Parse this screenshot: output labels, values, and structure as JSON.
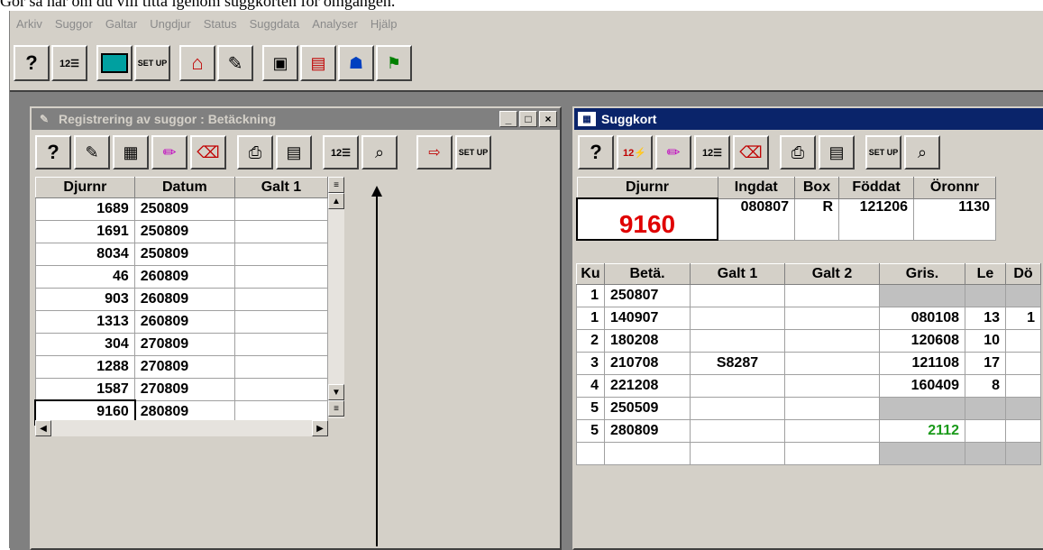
{
  "caption": "Gör så här om du vill titta igenom suggkorten för omgången.",
  "menu": [
    "Arkiv",
    "Suggor",
    "Galtar",
    "Ungdjur",
    "Status",
    "Suggdata",
    "Analyser",
    "Hjälp"
  ],
  "left_window": {
    "title": "Registrering av suggor : Betäckning",
    "columns": [
      "Djurnr",
      "Datum",
      "Galt 1"
    ],
    "rows": [
      [
        "1689",
        "250809",
        ""
      ],
      [
        "1691",
        "250809",
        ""
      ],
      [
        "8034",
        "250809",
        ""
      ],
      [
        "46",
        "260809",
        ""
      ],
      [
        "903",
        "260809",
        ""
      ],
      [
        "1313",
        "260809",
        ""
      ],
      [
        "304",
        "270809",
        ""
      ],
      [
        "1288",
        "270809",
        ""
      ],
      [
        "1587",
        "270809",
        ""
      ],
      [
        "9160",
        "280809",
        ""
      ]
    ]
  },
  "right_window": {
    "title": "Suggkort",
    "header_columns": [
      "Djurnr",
      "Ingdat",
      "Box",
      "Föddat",
      "Öronnr"
    ],
    "header_values": {
      "djurnr": "9160",
      "ingdat": "080807",
      "box": "R",
      "foddat": "121206",
      "oronnr": "1130"
    },
    "columns": [
      "Ku",
      "Betä.",
      "Galt 1",
      "Galt 2",
      "Gris.",
      "Le",
      "Dö"
    ],
    "rows": [
      {
        "ku": "1",
        "beta": "250807",
        "galt1": "",
        "galt2": "",
        "gris": "",
        "le": "",
        "do": "",
        "grey": true,
        "green": false
      },
      {
        "ku": "1",
        "beta": "140907",
        "galt1": "",
        "galt2": "",
        "gris": "080108",
        "le": "13",
        "do": "1",
        "grey": false,
        "green": false
      },
      {
        "ku": "2",
        "beta": "180208",
        "galt1": "",
        "galt2": "",
        "gris": "120608",
        "le": "10",
        "do": "",
        "grey": false,
        "green": false
      },
      {
        "ku": "3",
        "beta": "210708",
        "galt1": "S8287",
        "galt2": "",
        "gris": "121108",
        "le": "17",
        "do": "",
        "grey": false,
        "green": false
      },
      {
        "ku": "4",
        "beta": "221208",
        "galt1": "",
        "galt2": "",
        "gris": "160409",
        "le": "8",
        "do": "",
        "grey": false,
        "green": false
      },
      {
        "ku": "5",
        "beta": "250509",
        "galt1": "",
        "galt2": "",
        "gris": "",
        "le": "",
        "do": "",
        "grey": true,
        "green": false
      },
      {
        "ku": "5",
        "beta": "280809",
        "galt1": "",
        "galt2": "",
        "gris": "2112",
        "le": "",
        "do": "",
        "grey": false,
        "green": true
      }
    ]
  },
  "colors": {
    "red": "#e00000",
    "green": "#1a9a1a",
    "title_active": "#0a246a",
    "title_inactive": "#808080"
  }
}
